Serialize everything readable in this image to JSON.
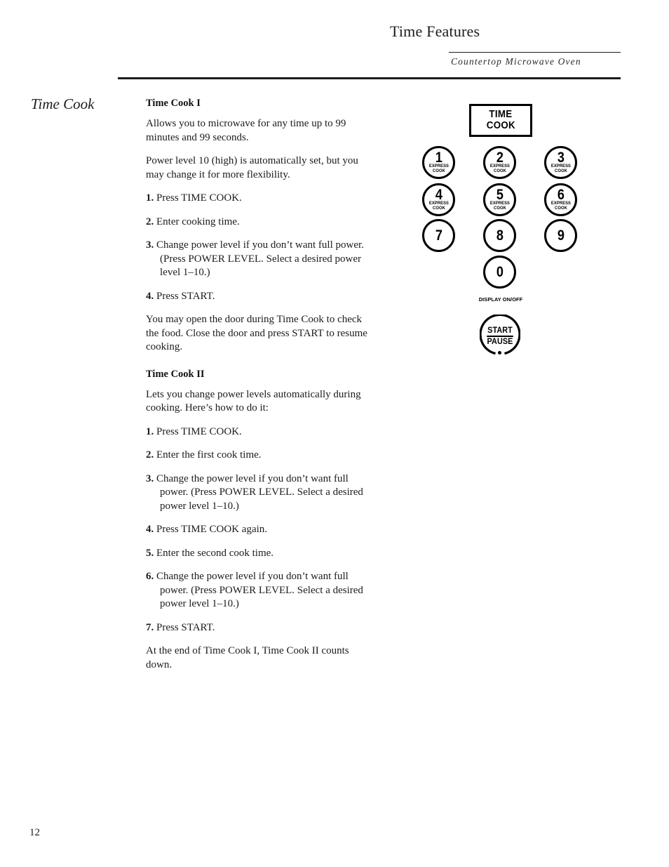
{
  "header": {
    "title": "Time Features",
    "subtitle": "Countertop Microwave Oven"
  },
  "section": {
    "heading": "Time Cook"
  },
  "body": {
    "blocks": [
      {
        "kind": "subhead",
        "text": "Time Cook I"
      },
      {
        "kind": "para",
        "text": "Allows you to microwave for any time up to 99 minutes and 99 seconds."
      },
      {
        "kind": "para",
        "text": "Power level 10 (high) is automatically set, but you may change it for more flexibility."
      },
      {
        "kind": "step",
        "num": "1.",
        "text": "Press TIME COOK."
      },
      {
        "kind": "step",
        "num": "2.",
        "text": "Enter cooking time."
      },
      {
        "kind": "step",
        "num": "3.",
        "text": "Change power level if you don’t want full power. (Press POWER LEVEL. Select a desired power level 1–10.)"
      },
      {
        "kind": "step",
        "num": "4.",
        "text": "Press START."
      },
      {
        "kind": "para",
        "text": "You may open the door during Time Cook to check the food. Close the door and press START to resume cooking."
      },
      {
        "kind": "subhead",
        "text": "Time Cook II"
      },
      {
        "kind": "para",
        "text": "Lets you change power levels automatically during cooking. Here’s how to do it:"
      },
      {
        "kind": "step",
        "num": "1.",
        "text": "Press TIME COOK."
      },
      {
        "kind": "step",
        "num": "2.",
        "text": "Enter the first cook time."
      },
      {
        "kind": "step",
        "num": "3.",
        "text": "Change the power level if you don’t want full power. (Press POWER LEVEL. Select a desired power level 1–10.)"
      },
      {
        "kind": "step",
        "num": "4.",
        "text": "Press TIME COOK again."
      },
      {
        "kind": "step",
        "num": "5.",
        "text": "Enter the second cook time."
      },
      {
        "kind": "step",
        "num": "6.",
        "text": "Change the power level if you don’t want full power. (Press POWER LEVEL. Select a desired power level 1–10.)"
      },
      {
        "kind": "step",
        "num": "7.",
        "text": "Press START."
      },
      {
        "kind": "para",
        "text": "At the end of Time Cook I, Time Cook II counts down."
      }
    ]
  },
  "keypad": {
    "time_cook_button": {
      "line1": "TIME",
      "line2": "COOK"
    },
    "keys": [
      {
        "digit": "1",
        "sub1": "EXPRESS",
        "sub2": "COOK"
      },
      {
        "digit": "2",
        "sub1": "EXPRESS",
        "sub2": "COOK"
      },
      {
        "digit": "3",
        "sub1": "EXPRESS",
        "sub2": "COOK"
      },
      {
        "digit": "4",
        "sub1": "EXPRESS",
        "sub2": "COOK"
      },
      {
        "digit": "5",
        "sub1": "EXPRESS",
        "sub2": "COOK"
      },
      {
        "digit": "6",
        "sub1": "EXPRESS",
        "sub2": "COOK"
      },
      {
        "digit": "7",
        "sub1": "",
        "sub2": ""
      },
      {
        "digit": "8",
        "sub1": "",
        "sub2": ""
      },
      {
        "digit": "9",
        "sub1": "",
        "sub2": ""
      },
      {
        "digit": "0",
        "sub1": "",
        "sub2": ""
      }
    ],
    "zero_caption": "DISPLAY ON/OFF",
    "start_pause_button": {
      "line1": "START",
      "line2": "PAUSE"
    }
  },
  "footer": {
    "page_number": "12"
  },
  "colors": {
    "ink": "#1c1c1c",
    "rule": "#1c1c1c",
    "diagram": "#000000",
    "background": "#ffffff"
  }
}
